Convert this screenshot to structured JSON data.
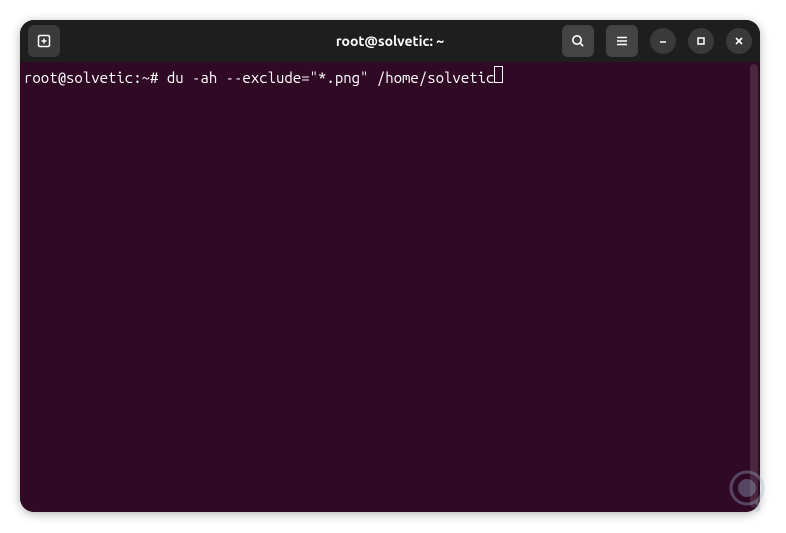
{
  "window": {
    "title": "root@solvetic: ~"
  },
  "terminal": {
    "prompt_user": "root@solvetic",
    "prompt_path": "~",
    "prompt_symbol": "#",
    "command": "du -ah --exclude=\"*.png\" /home/solvetic"
  },
  "icons": {
    "new_tab": "new-tab",
    "search": "search",
    "menu": "menu",
    "minimize": "minimize",
    "maximize": "maximize",
    "close": "close"
  }
}
